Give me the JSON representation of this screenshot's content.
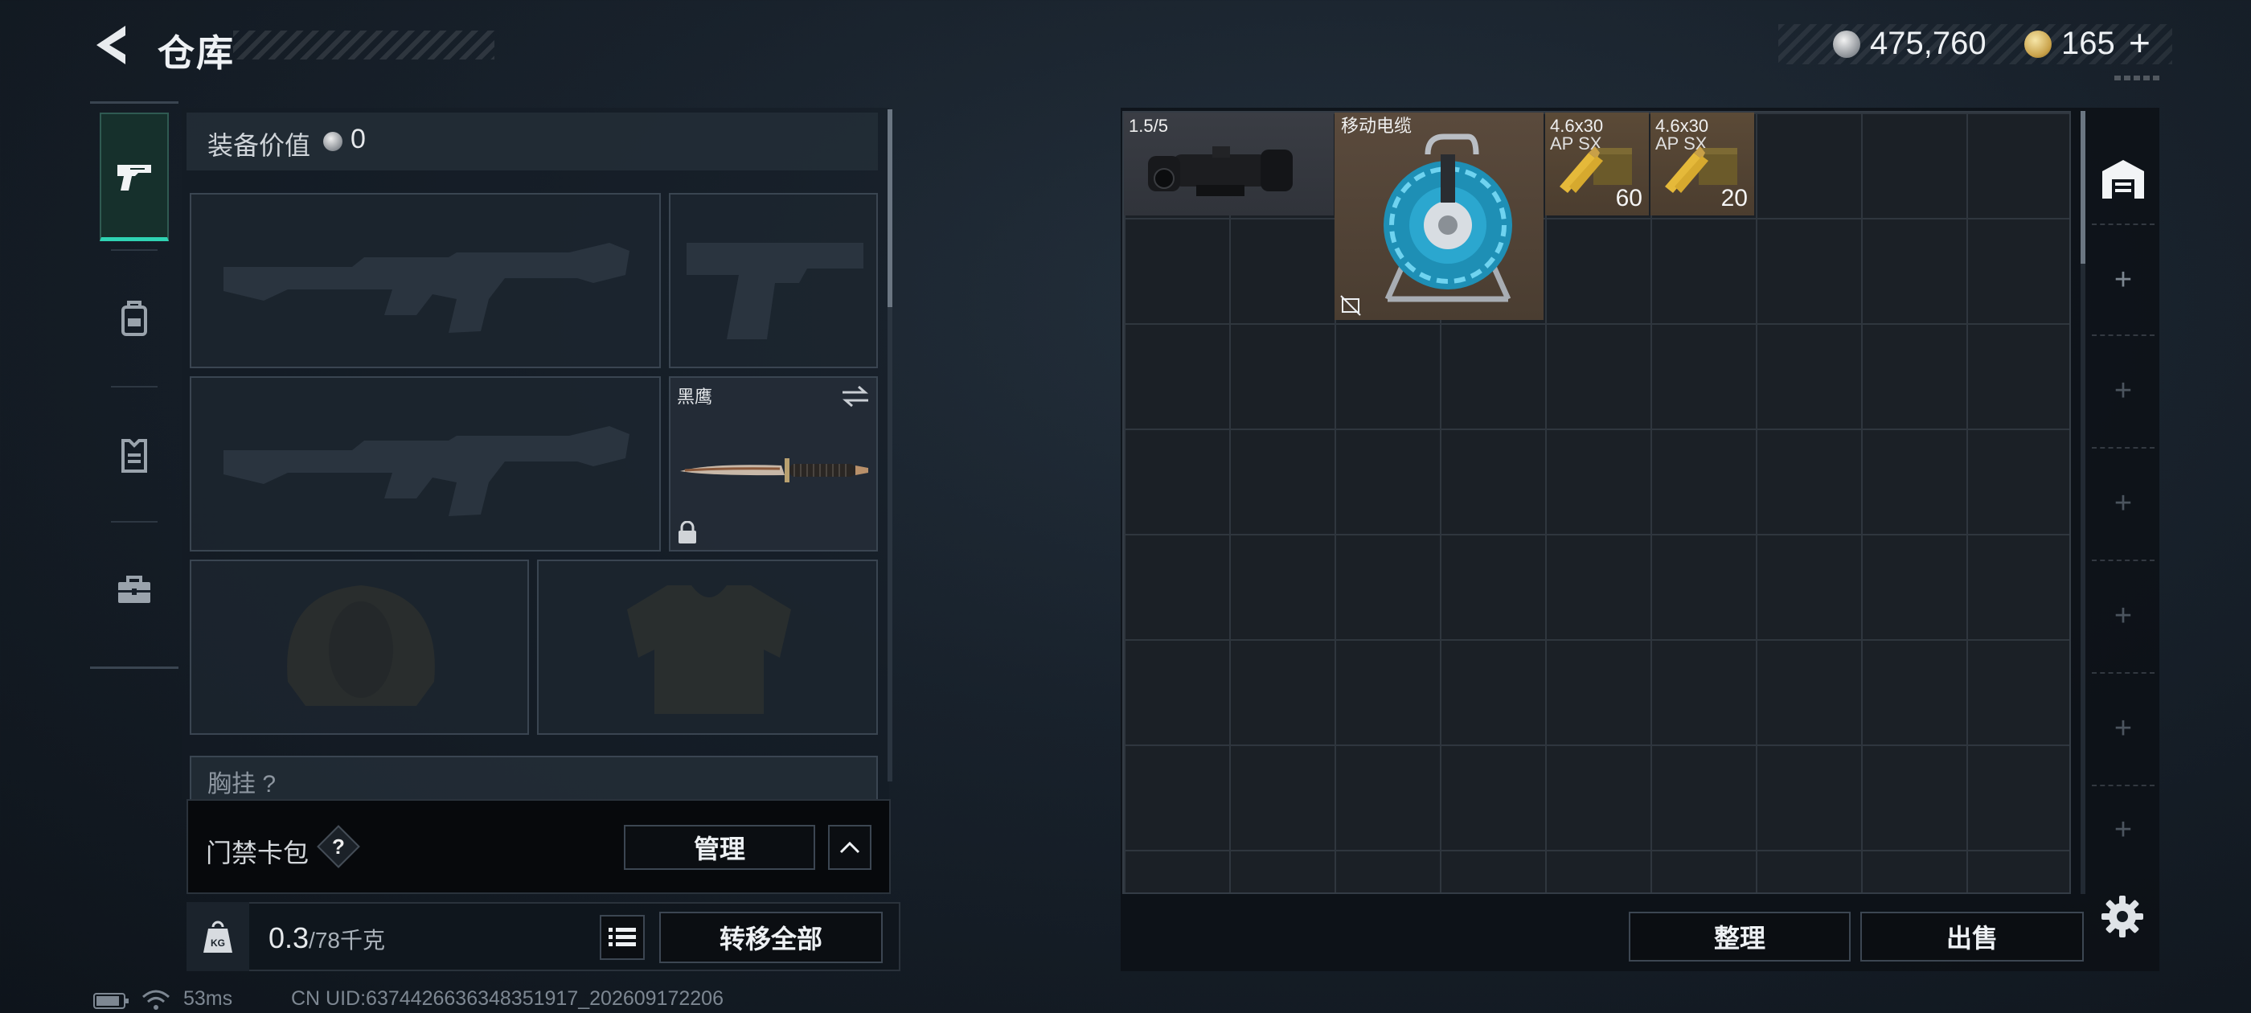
{
  "header": {
    "title": "仓库",
    "silver_amount": "475,760",
    "gold_amount": "165"
  },
  "nav": {
    "items": [
      "weapons-icon",
      "backpack-icon",
      "armor-vest-icon",
      "briefcase-icon"
    ],
    "active_index": 0,
    "accent_color": "#2fd3b3"
  },
  "equipment": {
    "value_label": "装备价值",
    "value": "0",
    "melee_name": "黑鹰",
    "chest_rig_label": "胸挂 ?"
  },
  "card_bar": {
    "label": "门禁卡包",
    "help": "?",
    "manage_label": "管理"
  },
  "weight": {
    "current": "0.3",
    "max": "/78千克",
    "kg_icon_text": "KG",
    "transfer_label": "转移全部"
  },
  "status_bar": {
    "ping": "53ms",
    "uid": "CN UID:6374426636348351917_202609172206"
  },
  "stash": {
    "items": [
      {
        "name": "1.5/5",
        "kind": "scope"
      },
      {
        "name": "移动电缆",
        "kind": "cable-reel"
      },
      {
        "name_line1": "4.6x30",
        "name_line2": "AP SX",
        "qty": "60"
      },
      {
        "name_line1": "4.6x30",
        "name_line2": "AP SX",
        "qty": "20"
      }
    ],
    "sort_label": "整理",
    "sell_label": "出售"
  }
}
